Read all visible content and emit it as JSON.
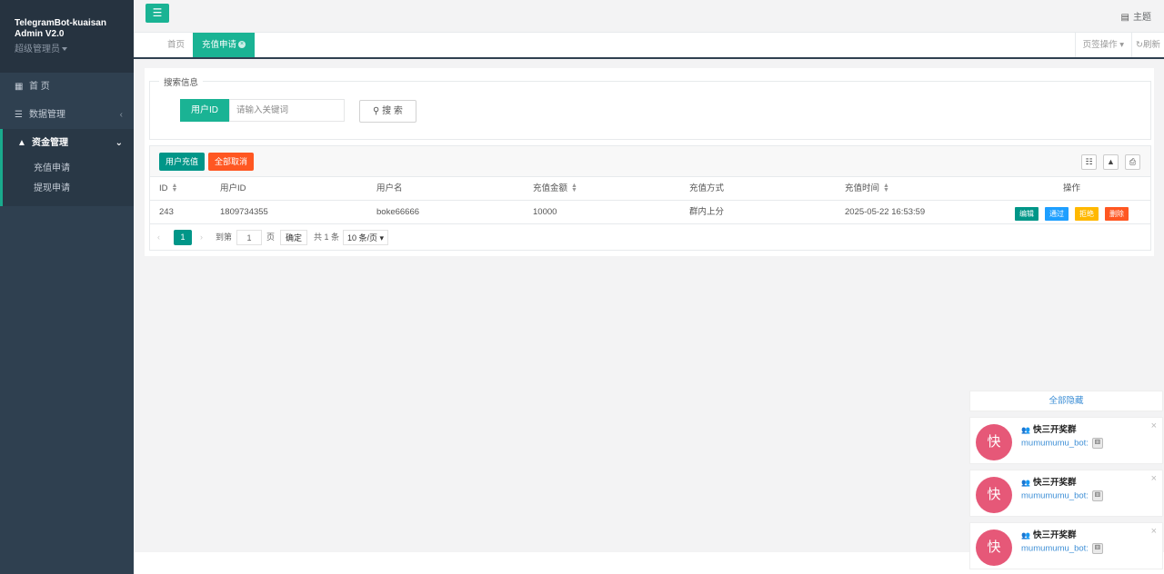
{
  "sidebar": {
    "title": "TelegramBot-kuaisan Admin V2.0",
    "role": "超级管理员",
    "items": [
      {
        "label": "首 页",
        "icon": "grid-icon"
      },
      {
        "label": "数据管理",
        "icon": "list-icon"
      },
      {
        "label": "资金管理",
        "icon": "fund-icon"
      }
    ],
    "sub_items": [
      {
        "label": "充值申请"
      },
      {
        "label": "提现申请"
      }
    ]
  },
  "topbar": {
    "menu_icon": "hamburger-icon",
    "theme_label": "主题"
  },
  "tabs": {
    "home": "首页",
    "active": "充值申请",
    "tab_ops": "页签操作",
    "refresh": "刷新"
  },
  "search": {
    "legend": "搜索信息",
    "field_label": "用户ID",
    "placeholder": "请输入关键词",
    "button": "搜 索"
  },
  "toolbar": {
    "recharge_button": "用户充值",
    "cancel_all_button": "全部取消"
  },
  "table": {
    "headers": [
      "ID",
      "用户ID",
      "用户名",
      "充值金额",
      "充值方式",
      "充值时间",
      "操作"
    ],
    "rows": [
      {
        "id": "243",
        "user_id": "1809734355",
        "username": "boke66666",
        "amount": "10000",
        "method": "群内上分",
        "time": "2025-05-22 16:53:59"
      }
    ],
    "actions": {
      "edit": "编辑",
      "approve": "通过",
      "reject": "拒绝",
      "delete": "删除"
    }
  },
  "pager": {
    "current_page": "1",
    "goto_label": "到第",
    "goto_value": "1",
    "page_unit": "页",
    "confirm": "确定",
    "total": "共 1 条",
    "page_size": "10 条/页"
  },
  "notifications": {
    "hide_all": "全部隐藏",
    "items": [
      {
        "avatar": "快",
        "title": "快三开奖群",
        "sender": "mumumumu_bot:"
      },
      {
        "avatar": "快",
        "title": "快三开奖群",
        "sender": "mumumumu_bot:"
      },
      {
        "avatar": "快",
        "title": "快三开奖群",
        "sender": "mumumumu_bot:"
      }
    ]
  },
  "colors": {
    "sidebar": "#2f4050",
    "accent": "#1ab394",
    "primary_btn": "#009688",
    "orange": "#ff5722",
    "blue": "#1e9fff",
    "yellow": "#ffb800",
    "avatar": "#e65878"
  }
}
